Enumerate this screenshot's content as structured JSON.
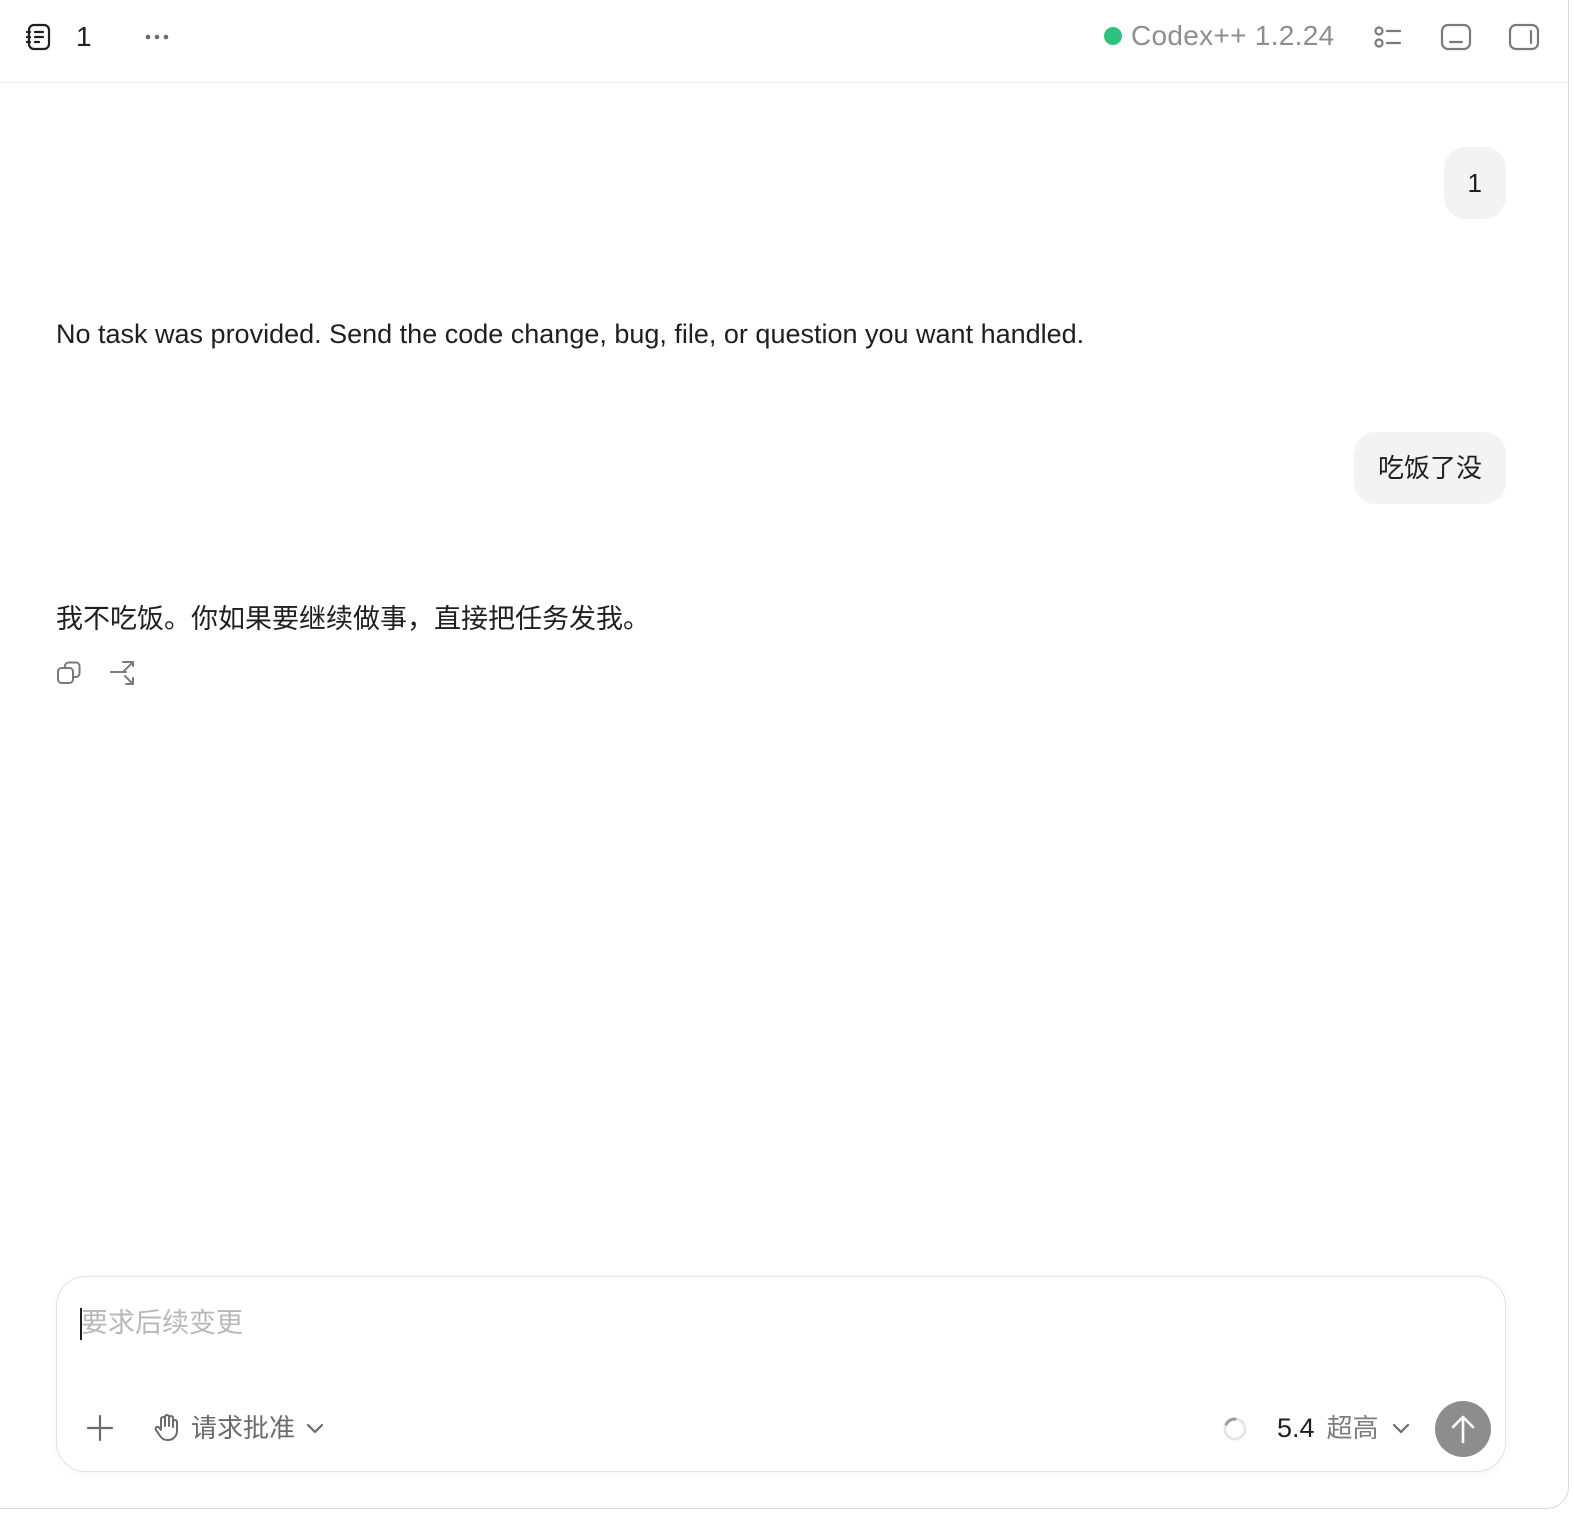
{
  "header": {
    "thread_title": "1",
    "status_color": "#2ec27e",
    "app_version": "Codex++ 1.2.24",
    "icons": [
      "thread-icon",
      "more-icon",
      "list-icon",
      "panel-bottom-icon",
      "panel-right-icon"
    ]
  },
  "conversation": {
    "messages": [
      {
        "role": "user",
        "text": "1"
      },
      {
        "role": "assistant",
        "text": "No task was provided. Send the code change, bug, file, or question you want handled."
      },
      {
        "role": "user",
        "text": "吃饭了没"
      },
      {
        "role": "assistant",
        "text": "我不吃饭。你如果要继续做事，直接把任务发我。"
      }
    ],
    "message_actions": [
      "copy-icon",
      "fork-icon"
    ]
  },
  "composer": {
    "value": "",
    "placeholder": "要求后续变更",
    "approval_label": "请求批准",
    "model_version": "5.4",
    "reasoning_effort": "超高",
    "send_button_color": "#8d8d8d",
    "icons": [
      "plus-icon",
      "hand-icon",
      "chevron-down-icon",
      "spinner-icon",
      "arrow-up-icon"
    ]
  }
}
